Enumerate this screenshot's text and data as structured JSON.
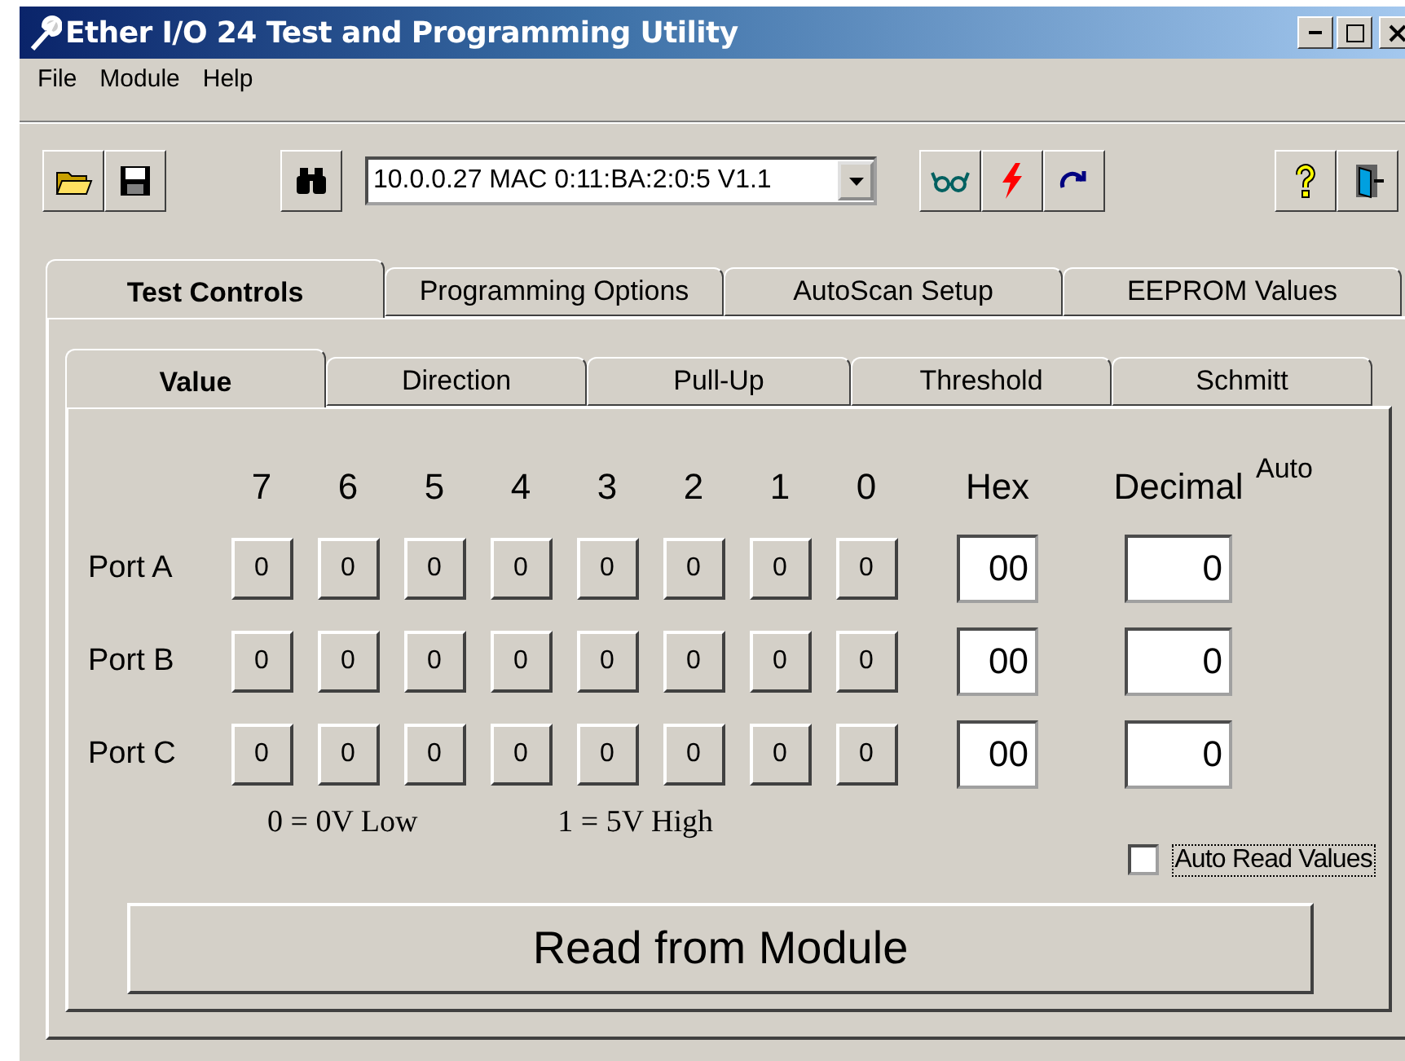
{
  "window": {
    "title": "Ether I/O 24 Test and Programming Utility"
  },
  "menu": [
    "File",
    "Module",
    "Help"
  ],
  "toolbar": {
    "device": "10.0.0.27  MAC 0:11:BA:2:0:5 V1.1"
  },
  "tabs": [
    {
      "label": "Test Controls",
      "selected": true
    },
    {
      "label": "Programming Options",
      "selected": false
    },
    {
      "label": "AutoScan Setup",
      "selected": false
    },
    {
      "label": "EEPROM Values",
      "selected": false
    }
  ],
  "sub_tabs": [
    {
      "label": "Value",
      "selected": true
    },
    {
      "label": "Direction",
      "selected": false
    },
    {
      "label": "Pull-Up",
      "selected": false
    },
    {
      "label": "Threshold",
      "selected": false
    },
    {
      "label": "Schmitt",
      "selected": false
    }
  ],
  "bit_headers": [
    "7",
    "6",
    "5",
    "4",
    "3",
    "2",
    "1",
    "0"
  ],
  "hex_header": "Hex",
  "decimal_header": "Decimal",
  "auto_header": "Auto",
  "ports": [
    {
      "name": "Port A",
      "bits": [
        "0",
        "0",
        "0",
        "0",
        "0",
        "0",
        "0",
        "0"
      ],
      "hex": "00",
      "decimal": "0"
    },
    {
      "name": "Port B",
      "bits": [
        "0",
        "0",
        "0",
        "0",
        "0",
        "0",
        "0",
        "0"
      ],
      "hex": "00",
      "decimal": "0"
    },
    {
      "name": "Port C",
      "bits": [
        "0",
        "0",
        "0",
        "0",
        "0",
        "0",
        "0",
        "0"
      ],
      "hex": "00",
      "decimal": "0"
    }
  ],
  "legend": [
    "0 = 0V Low",
    "1 = 5V High"
  ],
  "auto_read": {
    "label": "Auto Read Values",
    "checked": false
  },
  "read_button": "Read from Module"
}
